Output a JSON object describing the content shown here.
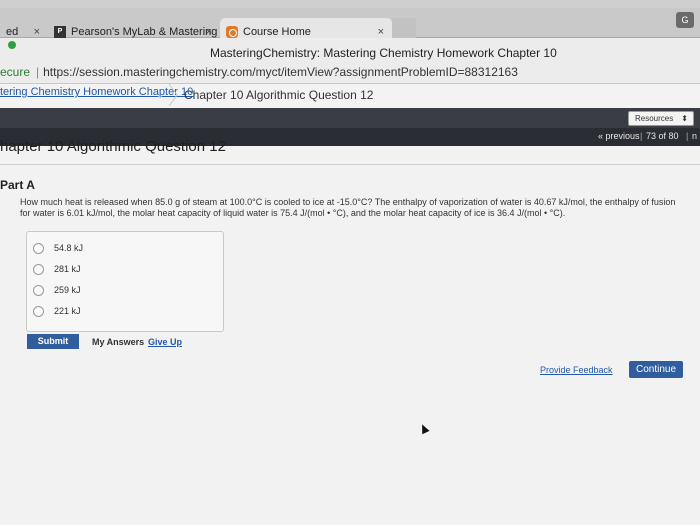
{
  "browser": {
    "menu_partial": "",
    "tabs": [
      {
        "label": "ed",
        "close": "×"
      },
      {
        "label": "Pearson's MyLab & Mastering",
        "close": "×"
      },
      {
        "label": "Course Home",
        "close": "×"
      },
      {
        "label": "",
        "close": ""
      }
    ],
    "window_title": "MasteringChemistry: Mastering Chemistry Homework Chapter 10",
    "secure_label": "ecure",
    "url": "https://session.masteringchemistry.com/myct/itemView?assignmentProblemID=88312163"
  },
  "breadcrumb": {
    "link": "tering Chemistry Homework Chapter 10",
    "current": "Chapter 10 Algorithmic Question 12"
  },
  "toolbar": {
    "resources_label": "Resources",
    "previous_label": "« previous",
    "count_label": "73 of 80",
    "next_label": "n"
  },
  "problem": {
    "title": "hapter 10 Algorithmic Question 12",
    "part_label": "Part A",
    "question": "How much heat is released when 85.0 g of steam at 100.0°C is cooled to ice at -15.0°C? The enthalpy of vaporization of water is 40.67 kJ/mol, the enthalpy of fusion for water is 6.01 kJ/mol, the molar heat capacity of liquid water is 75.4 J/(mol • °C), and the molar heat capacity of ice is 36.4 J/(mol • °C).",
    "options": [
      "54.8 kJ",
      "281 kJ",
      "259 kJ",
      "221 kJ"
    ],
    "submit_label": "Submit",
    "my_answers_label": "My Answers",
    "give_up_label": "Give Up"
  },
  "footer": {
    "feedback_label": "Provide Feedback",
    "continue_label": "Continue"
  },
  "colors": {
    "accent": "#2f5d9e",
    "link": "#2158a8",
    "dark_band": "#3a3d44"
  }
}
